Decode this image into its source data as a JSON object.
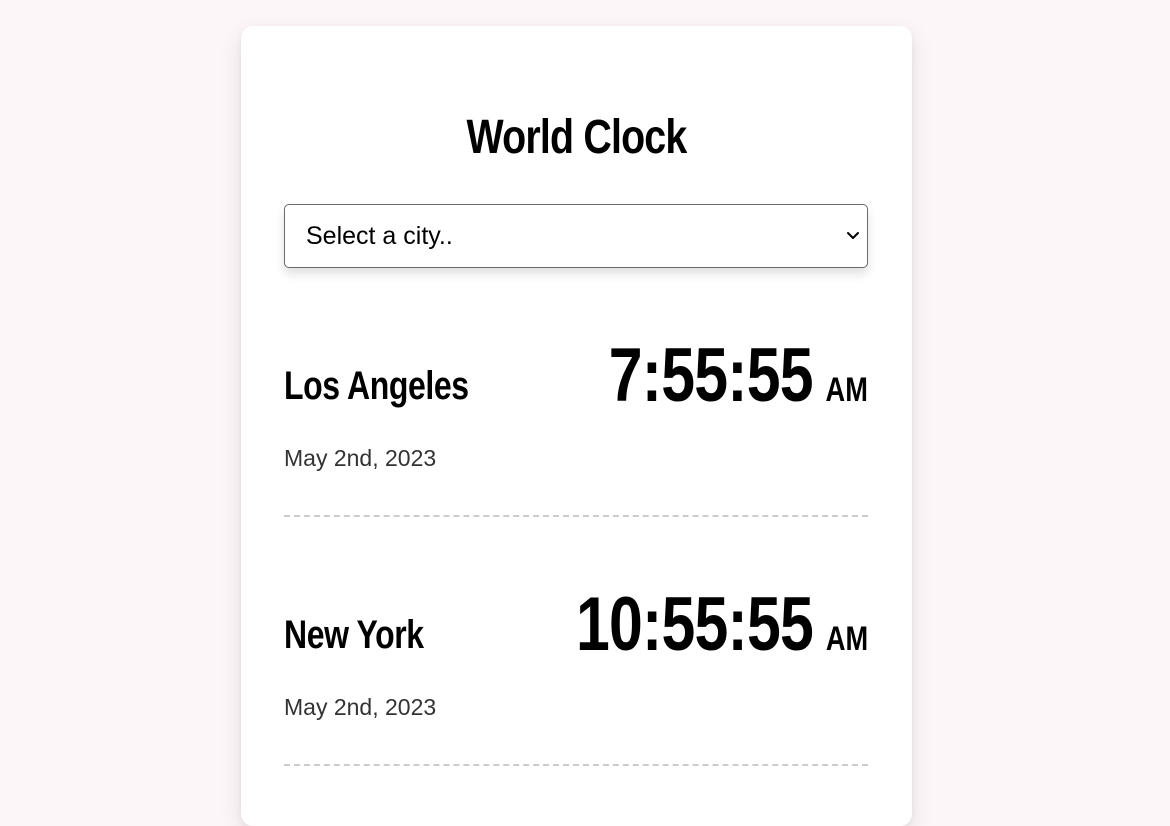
{
  "page": {
    "title": "World Clock"
  },
  "city_select": {
    "selected": "Select a city..",
    "icon": "chevron-down-icon"
  },
  "cities": [
    {
      "name": "Los Angeles",
      "date": "May 2nd, 2023",
      "time": "7:55:55",
      "ampm": "AM"
    },
    {
      "name": "New York",
      "date": "May 2nd, 2023",
      "time": "10:55:55",
      "ampm": "AM"
    }
  ],
  "colors": {
    "page_background": "#fdf6f8",
    "card_background": "#ffffff",
    "divider": "#cccccc"
  }
}
